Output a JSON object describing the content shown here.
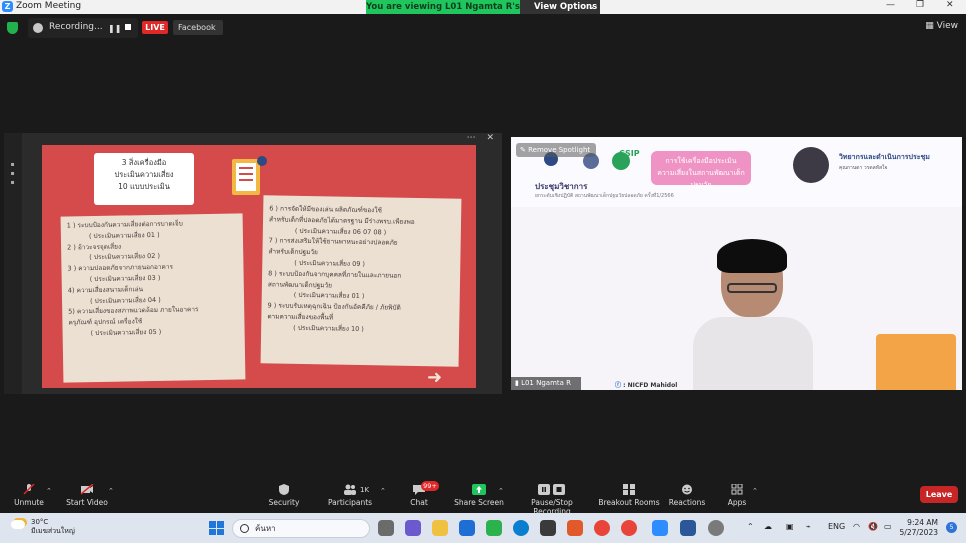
{
  "window": {
    "title": "Zoom Meeting"
  },
  "banner": {
    "viewing": "You are viewing L01 Ngamta R's screen",
    "view_options": "View Options"
  },
  "topbar": {
    "recording": "Recording...",
    "live": "LIVE",
    "stream_target": "Facebook",
    "view": "View"
  },
  "shared_slide": {
    "title_lines": [
      "3  สิ่งเครื่องมือ",
      "ประเมินความเสี่ยง",
      "10  แบบประเมิน"
    ],
    "left_items": [
      "1 ) ระบบป้องกันความเสี่ยงต่อการบาดเจ็บ",
      "( ประเมินความเสี่ยง 01 )",
      "2 ) อ้าวะจรจุดเสี่ยง",
      "( ประเมินความเสี่ยง 02 )",
      "3 ) ความปลอดภัยจากภายนอกอาคาร",
      "( ประเมินความเสี่ยง 03 )",
      "4)  ความเสี่ยงสนามเด็กเล่น",
      "( ประเมินความเสี่ยง 04 )",
      "5)  ความเสี่ยงของสภาพแวดล้อม  ภายในอาคาร",
      "ครุภัณฑ์  อุปกรณ์  เครื่องใช้",
      "( ประเมินความเสี่ยง 05 )"
    ],
    "right_items": [
      "6 )  การจัดให้มีของเล่น  ผลิตภัณฑ์ของใช้",
      "สำหรับเด็กที่ปลอดภัยได้มาตรฐาน  มีร่างพรบ.เพียงพอ",
      "( ประเมินความเสี่ยง 06 07 08 )",
      "7 )  การส่งเสริมให้ใช้ยานพาหนะอย่างปลอดภัย",
      "สำหรับเด็กปฐมวัย",
      "( ประเมินความเสี่ยง 09 )",
      "8 ) ระบบป้องกันจากบุคคลที่ภายในและภายนอก",
      "สถานพัฒนาเด็กปฐมวัย",
      "( ประเมินความเสี่ยง 01 )",
      "9 ) ระบบรับเหตุฉุกเฉิน ป้องกันอัคคีภัย / ภัยพิบัติ",
      "ตามความเสี่ยงของพื้นที่",
      "( ประเมินความเสี่ยง 10 )"
    ]
  },
  "speaker_video": {
    "remove_spotlight": "Remove Spotlight",
    "conference_title": "ประชุมวิชาการ",
    "conference_sub": "ยกระดับเชิงปฏิบัติ  สถานพัฒนาเด็กปฐมวัยปลอดภัย  ครั้งที่1/2566",
    "pink_title": [
      "การใช้เครื่องมือประเมิน",
      "ความเสี่ยงในสถานพัฒนาเด็กปฐมวัย"
    ],
    "csip": "CSIP",
    "speaker_title": "วิทยากรและดำเนินการประชุม",
    "speaker_name": "คุณกานดา  วรดลหัสใจ",
    "participant_name": "L01 Ngamta R",
    "footer_tag": ": NICFD Mahidol"
  },
  "toolbar": {
    "unmute": "Unmute",
    "start_video": "Start Video",
    "security": "Security",
    "participants": "Participants",
    "participants_count": "1K",
    "chat": "Chat",
    "chat_badge": "99+",
    "share_screen": "Share Screen",
    "recording": "Pause/Stop Recording",
    "breakout": "Breakout Rooms",
    "reactions": "Reactions",
    "apps": "Apps",
    "leave": "Leave"
  },
  "taskbar": {
    "temperature": "30°C",
    "weather_desc": "มีเมฆส่วนใหญ่",
    "search": "ค้นหา",
    "language": "ENG",
    "time": "9:24 AM",
    "date": "5/27/2023",
    "notifications": "5"
  },
  "colors": {
    "zoom_blue": "#2d8cff",
    "banner_green": "#21c55d",
    "leave_red": "#c82626",
    "slide_red": "#d54a4a"
  }
}
